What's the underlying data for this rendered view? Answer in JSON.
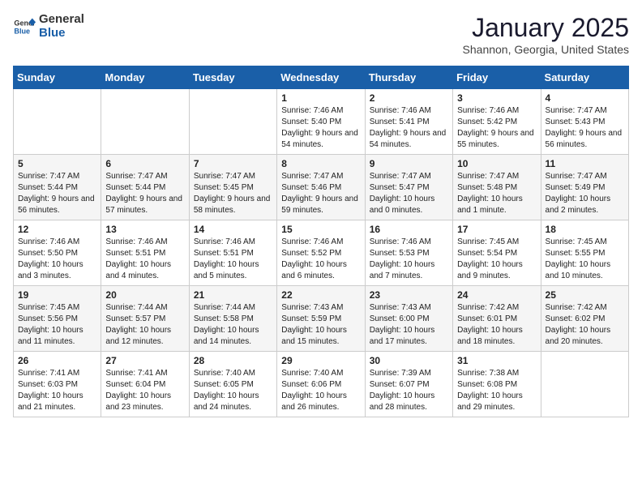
{
  "header": {
    "logo_general": "General",
    "logo_blue": "Blue",
    "month_title": "January 2025",
    "location": "Shannon, Georgia, United States"
  },
  "weekdays": [
    "Sunday",
    "Monday",
    "Tuesday",
    "Wednesday",
    "Thursday",
    "Friday",
    "Saturday"
  ],
  "weeks": [
    [
      {
        "day": "",
        "info": ""
      },
      {
        "day": "",
        "info": ""
      },
      {
        "day": "",
        "info": ""
      },
      {
        "day": "1",
        "info": "Sunrise: 7:46 AM\nSunset: 5:40 PM\nDaylight: 9 hours and 54 minutes."
      },
      {
        "day": "2",
        "info": "Sunrise: 7:46 AM\nSunset: 5:41 PM\nDaylight: 9 hours and 54 minutes."
      },
      {
        "day": "3",
        "info": "Sunrise: 7:46 AM\nSunset: 5:42 PM\nDaylight: 9 hours and 55 minutes."
      },
      {
        "day": "4",
        "info": "Sunrise: 7:47 AM\nSunset: 5:43 PM\nDaylight: 9 hours and 56 minutes."
      }
    ],
    [
      {
        "day": "5",
        "info": "Sunrise: 7:47 AM\nSunset: 5:44 PM\nDaylight: 9 hours and 56 minutes."
      },
      {
        "day": "6",
        "info": "Sunrise: 7:47 AM\nSunset: 5:44 PM\nDaylight: 9 hours and 57 minutes."
      },
      {
        "day": "7",
        "info": "Sunrise: 7:47 AM\nSunset: 5:45 PM\nDaylight: 9 hours and 58 minutes."
      },
      {
        "day": "8",
        "info": "Sunrise: 7:47 AM\nSunset: 5:46 PM\nDaylight: 9 hours and 59 minutes."
      },
      {
        "day": "9",
        "info": "Sunrise: 7:47 AM\nSunset: 5:47 PM\nDaylight: 10 hours and 0 minutes."
      },
      {
        "day": "10",
        "info": "Sunrise: 7:47 AM\nSunset: 5:48 PM\nDaylight: 10 hours and 1 minute."
      },
      {
        "day": "11",
        "info": "Sunrise: 7:47 AM\nSunset: 5:49 PM\nDaylight: 10 hours and 2 minutes."
      }
    ],
    [
      {
        "day": "12",
        "info": "Sunrise: 7:46 AM\nSunset: 5:50 PM\nDaylight: 10 hours and 3 minutes."
      },
      {
        "day": "13",
        "info": "Sunrise: 7:46 AM\nSunset: 5:51 PM\nDaylight: 10 hours and 4 minutes."
      },
      {
        "day": "14",
        "info": "Sunrise: 7:46 AM\nSunset: 5:51 PM\nDaylight: 10 hours and 5 minutes."
      },
      {
        "day": "15",
        "info": "Sunrise: 7:46 AM\nSunset: 5:52 PM\nDaylight: 10 hours and 6 minutes."
      },
      {
        "day": "16",
        "info": "Sunrise: 7:46 AM\nSunset: 5:53 PM\nDaylight: 10 hours and 7 minutes."
      },
      {
        "day": "17",
        "info": "Sunrise: 7:45 AM\nSunset: 5:54 PM\nDaylight: 10 hours and 9 minutes."
      },
      {
        "day": "18",
        "info": "Sunrise: 7:45 AM\nSunset: 5:55 PM\nDaylight: 10 hours and 10 minutes."
      }
    ],
    [
      {
        "day": "19",
        "info": "Sunrise: 7:45 AM\nSunset: 5:56 PM\nDaylight: 10 hours and 11 minutes."
      },
      {
        "day": "20",
        "info": "Sunrise: 7:44 AM\nSunset: 5:57 PM\nDaylight: 10 hours and 12 minutes."
      },
      {
        "day": "21",
        "info": "Sunrise: 7:44 AM\nSunset: 5:58 PM\nDaylight: 10 hours and 14 minutes."
      },
      {
        "day": "22",
        "info": "Sunrise: 7:43 AM\nSunset: 5:59 PM\nDaylight: 10 hours and 15 minutes."
      },
      {
        "day": "23",
        "info": "Sunrise: 7:43 AM\nSunset: 6:00 PM\nDaylight: 10 hours and 17 minutes."
      },
      {
        "day": "24",
        "info": "Sunrise: 7:42 AM\nSunset: 6:01 PM\nDaylight: 10 hours and 18 minutes."
      },
      {
        "day": "25",
        "info": "Sunrise: 7:42 AM\nSunset: 6:02 PM\nDaylight: 10 hours and 20 minutes."
      }
    ],
    [
      {
        "day": "26",
        "info": "Sunrise: 7:41 AM\nSunset: 6:03 PM\nDaylight: 10 hours and 21 minutes."
      },
      {
        "day": "27",
        "info": "Sunrise: 7:41 AM\nSunset: 6:04 PM\nDaylight: 10 hours and 23 minutes."
      },
      {
        "day": "28",
        "info": "Sunrise: 7:40 AM\nSunset: 6:05 PM\nDaylight: 10 hours and 24 minutes."
      },
      {
        "day": "29",
        "info": "Sunrise: 7:40 AM\nSunset: 6:06 PM\nDaylight: 10 hours and 26 minutes."
      },
      {
        "day": "30",
        "info": "Sunrise: 7:39 AM\nSunset: 6:07 PM\nDaylight: 10 hours and 28 minutes."
      },
      {
        "day": "31",
        "info": "Sunrise: 7:38 AM\nSunset: 6:08 PM\nDaylight: 10 hours and 29 minutes."
      },
      {
        "day": "",
        "info": ""
      }
    ]
  ]
}
